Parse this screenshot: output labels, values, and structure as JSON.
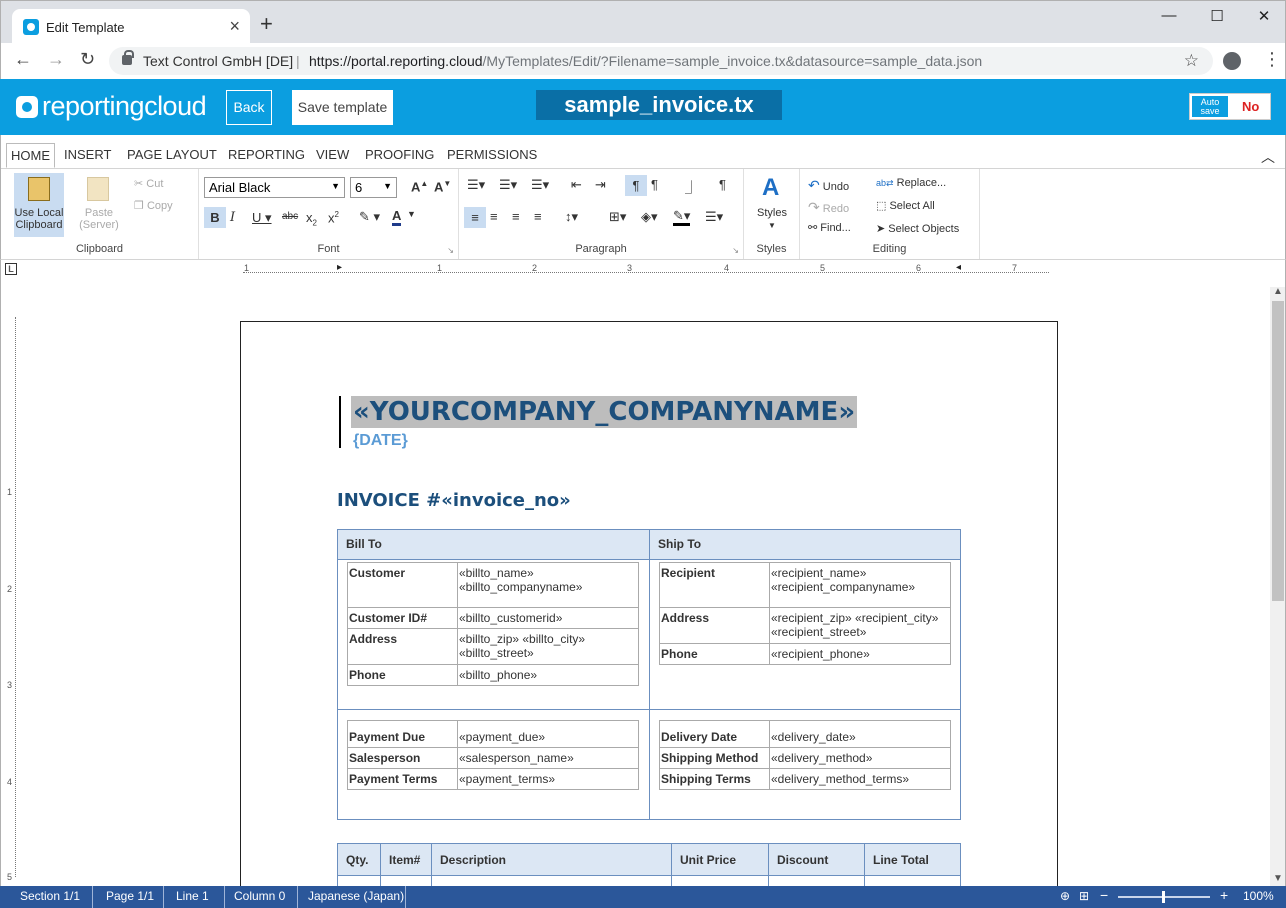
{
  "browser": {
    "tab_title": "Edit Template",
    "site_name": "Text Control GmbH [DE]",
    "url_host": "https://portal.reporting.cloud",
    "url_path": "/MyTemplates/Edit/?Filename=sample_invoice.tx&datasource=sample_data.json"
  },
  "app": {
    "logo_text": "reportingcloud",
    "back_label": "Back",
    "save_label": "Save template",
    "document_name": "sample_invoice.tx",
    "autosave_label": "Auto save",
    "autosave_value": "No",
    "brand_color": "#0b9ee0"
  },
  "ribbon": {
    "tabs": [
      "HOME",
      "INSERT",
      "PAGE LAYOUT",
      "REPORTING",
      "VIEW",
      "PROOFING",
      "PERMISSIONS"
    ],
    "active_tab": "HOME",
    "clipboard": {
      "group_label": "Clipboard",
      "use_local": "Use Local Clipboard",
      "paste_server": "Paste (Server)",
      "cut": "Cut",
      "copy": "Copy"
    },
    "font": {
      "group_label": "Font",
      "font_name": "Arial Black",
      "font_size": "6"
    },
    "paragraph": {
      "group_label": "Paragraph"
    },
    "styles": {
      "group_label": "Styles",
      "styles_label": "Styles"
    },
    "editing": {
      "group_label": "Editing",
      "undo": "Undo",
      "redo": "Redo",
      "find": "Find...",
      "replace": "Replace...",
      "select_all": "Select All",
      "select_objects": "Select Objects"
    }
  },
  "ruler": {
    "h_numbers": [
      "1",
      "1",
      "2",
      "3",
      "4",
      "5",
      "6",
      "7"
    ],
    "v_numbers": [
      "1",
      "2",
      "3",
      "4",
      "5"
    ]
  },
  "document": {
    "company": "«YOURCOMPANY_COMPANYNAME»",
    "date": "{DATE}",
    "invoice_title": "INVOICE #«invoice_no»",
    "bill_to": {
      "header": "Bill To",
      "rows": [
        {
          "k": "Customer",
          "v": "«billto_name»\n«billto_companyname»"
        },
        {
          "k": "Customer ID#",
          "v": "«billto_customerid»"
        },
        {
          "k": "Address",
          "v": "«billto_zip» «billto_city»\n«billto_street»"
        },
        {
          "k": "Phone",
          "v": "«billto_phone»"
        }
      ]
    },
    "ship_to": {
      "header": "Ship To",
      "rows": [
        {
          "k": "Recipient",
          "v": "«recipient_name»\n«recipient_companyname»"
        },
        {
          "k": "Address",
          "v": "«recipient_zip» «recipient_city»\n«recipient_street»"
        },
        {
          "k": "Phone",
          "v": "«recipient_phone»"
        }
      ]
    },
    "payment": [
      {
        "k": "Payment Due",
        "v": "«payment_due»"
      },
      {
        "k": "Salesperson",
        "v": "«salesperson_name»"
      },
      {
        "k": "Payment Terms",
        "v": "«payment_terms»"
      }
    ],
    "delivery": [
      {
        "k": "Delivery Date",
        "v": "«delivery_date»"
      },
      {
        "k": "Shipping Method",
        "v": "«delivery_method»"
      },
      {
        "k": "Shipping Terms",
        "v": "«delivery_method_terms»"
      }
    ],
    "line_items_headers": [
      "Qty.",
      "Item#",
      "Description",
      "Unit Price",
      "Discount",
      "Line Total"
    ]
  },
  "status": {
    "section": "Section 1/1",
    "page": "Page 1/1",
    "line": "Line 1",
    "column": "Column 0",
    "language": "Japanese (Japan)",
    "zoom": "100%",
    "zoom_minus": "−",
    "zoom_plus": "+"
  }
}
